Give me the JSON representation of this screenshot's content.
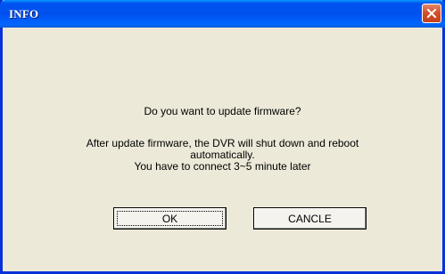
{
  "window": {
    "title": "INFO"
  },
  "dialog": {
    "question": "Do you want to update firmware?",
    "message_lines": [
      "After update firmware, the DVR will shut down and reboot",
      "automatically.",
      "You have to connect 3~5 minute later"
    ],
    "ok_label": "OK",
    "cancel_label": "CANCLE"
  },
  "colors": {
    "titlebar": "#0053ee",
    "background": "#ece9d8",
    "close": "#d5512c"
  }
}
